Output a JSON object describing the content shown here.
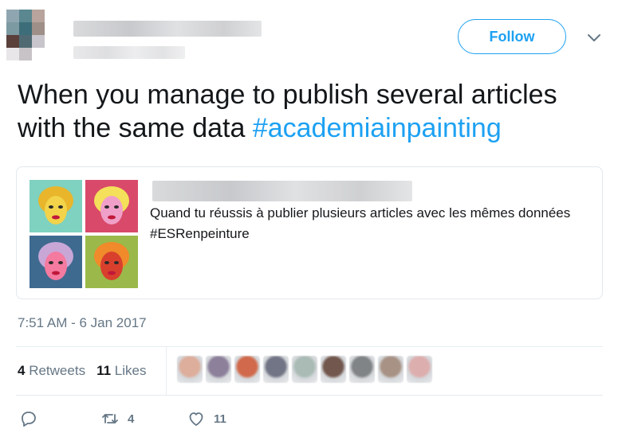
{
  "header": {
    "follow_label": "Follow",
    "avatar_colors": [
      "#8fa6b0",
      "#5a8790",
      "#b8a49c",
      "#ffffff",
      "#7c9aa2",
      "#3c6d78",
      "#9e8f88",
      "#ffffff",
      "#5a3f3a",
      "#4f6a73",
      "#c9c5cc",
      "#ffffff",
      "#e9e6ea",
      "#c8c3c6",
      "#ffffff",
      "#ffffff"
    ]
  },
  "tweet": {
    "text_plain": "When you manage to publish several articles with the same data ",
    "hashtag": "#academiainpainting"
  },
  "quote": {
    "text": "Quand tu réussis à publier plusieurs articles avec les mêmes données #ESRenpeinture",
    "tiles": [
      {
        "bg": "#7fd1c0",
        "face": "#f2d34a",
        "hair": "#e8b52b"
      },
      {
        "bg": "#d94a6a",
        "face": "#f0a0c8",
        "hair": "#f4e05a"
      },
      {
        "bg": "#3f6a90",
        "face": "#f47aa0",
        "hair": "#c8a7d7"
      },
      {
        "bg": "#9ab94a",
        "face": "#d8402d",
        "hair": "#f08a2a"
      }
    ]
  },
  "timestamp": "7:51 AM - 6 Jan 2017",
  "stats": {
    "retweets_count": "4",
    "retweets_label": "Retweets",
    "likes_count": "11",
    "likes_label": "Likes"
  },
  "likers": [
    "#d7a08a",
    "#7a6a8a",
    "#c9512d",
    "#5a5d70",
    "#9bb0a8",
    "#5a3a30",
    "#6c6f72",
    "#9a8070",
    "#d8a0a0"
  ],
  "actions": {
    "retweet_count": "4",
    "like_count": "11"
  }
}
